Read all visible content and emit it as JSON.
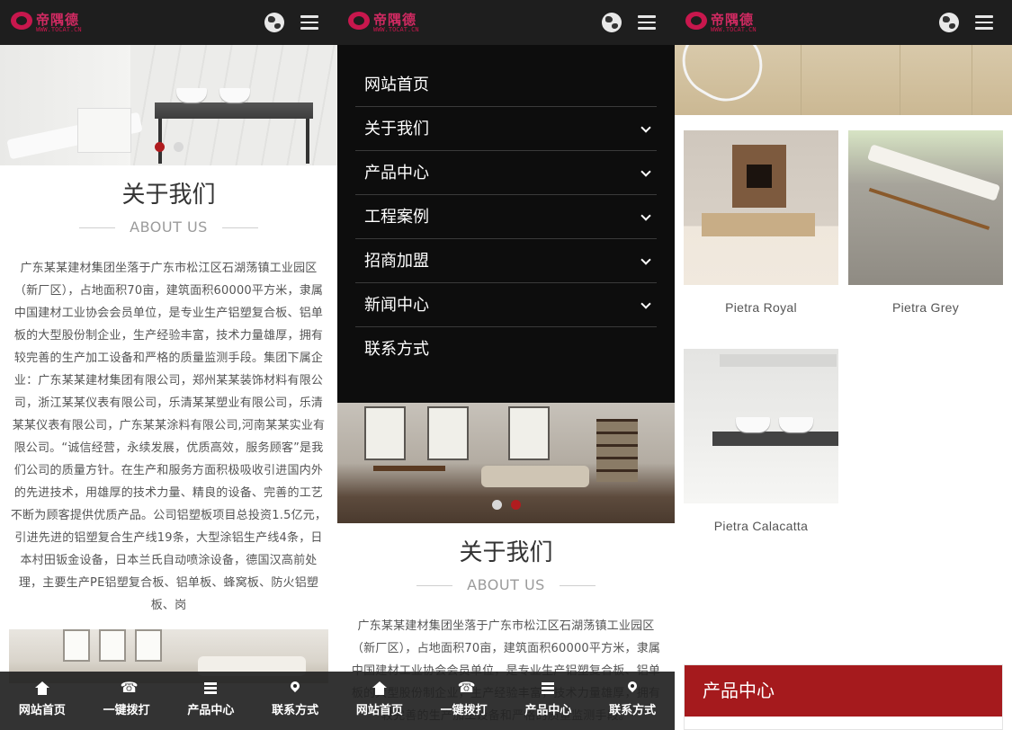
{
  "header": {
    "logo_name": "帝隅德",
    "logo_url": "WWW.TOCAT.CN"
  },
  "panel1": {
    "about_title": "关于我们",
    "about_sub": "ABOUT US",
    "about_text": "广东某某建材集团坐落于广东市松江区石湖荡镇工业园区（新厂区），占地面积70亩，建筑面积60000平方米，隶属中国建材工业协会会员单位，是专业生产铝塑复合板、铝单板的大型股份制企业，生产经验丰富，技术力量雄厚，拥有较完善的生产加工设备和严格的质量监测手段。集团下属企业：广东某某建材集团有限公司，郑州某某装饰材料有限公司，浙江某某仪表有限公司，乐清某某塑业有限公司，乐清某某仪表有限公司，广东某某涂料有限公司,河南某某实业有限公司。“诚信经营，永续发展，优质高效，服务顾客”是我们公司的质量方针。在生产和服务方面积极吸收引进国内外的先进技术，用雄厚的技术力量、精良的设备、完善的工艺不断为顾客提供优质产品。公司铝塑板项目总投资1.5亿元，引进先进的铝塑复合生产线19条，大型涂铝生产线4条，日本村田钣金设备，日本兰氏自动喷涂设备，德国汉高前处理，主要生产PE铝塑复合板、铝单板、蜂窝板、防火铝塑板、岗"
  },
  "panel2": {
    "menu": [
      {
        "label": "网站首页",
        "has_sub": false
      },
      {
        "label": "关于我们",
        "has_sub": true
      },
      {
        "label": "产品中心",
        "has_sub": true
      },
      {
        "label": "工程案例",
        "has_sub": true
      },
      {
        "label": "招商加盟",
        "has_sub": true
      },
      {
        "label": "新闻中心",
        "has_sub": true
      },
      {
        "label": "联系方式",
        "has_sub": false
      }
    ],
    "about_title": "关于我们",
    "about_sub": "ABOUT US",
    "about_text": "广东某某建材集团坐落于广东市松江区石湖荡镇工业园区（新厂区），占地面积70亩，建筑面积60000平方米，隶属中国建材工业协会会员单位，是专业生产铝塑复合板、铝单板的大型股份制企业，生产经验丰富，技术力量雄厚，拥有较完善的生产加工设备和严格的质量监测手段。"
  },
  "panel3": {
    "products": [
      {
        "name": "Pietra Royal"
      },
      {
        "name": "Pietra Grey"
      },
      {
        "name": "Pietra Calacatta"
      }
    ],
    "category_title": "产品中心"
  },
  "bottom_nav": [
    {
      "label": "网站首页",
      "icon": "home-icon"
    },
    {
      "label": "一键拨打",
      "icon": "phone-icon"
    },
    {
      "label": "产品中心",
      "icon": "list-icon"
    },
    {
      "label": "联系方式",
      "icon": "location-pin-icon"
    }
  ],
  "colors": {
    "topbar": "#1e1e1e",
    "accent": "#a51a1d",
    "logo": "#c8174d",
    "menu_bg": "#0d0d0d"
  },
  "carousel": {
    "panel1_active_slide": 1,
    "panel2_active_slide": 2,
    "slide_count": 2
  }
}
